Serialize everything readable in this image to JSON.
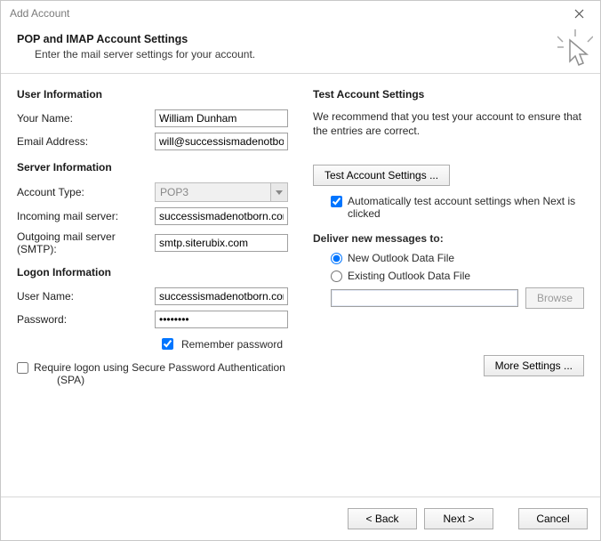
{
  "window": {
    "title": "Add Account"
  },
  "header": {
    "title": "POP and IMAP Account Settings",
    "subtitle": "Enter the mail server settings for your account."
  },
  "left": {
    "user_section": "User Information",
    "your_name_label": "Your Name:",
    "your_name_value": "William Dunham",
    "email_label": "Email Address:",
    "email_value": "will@successismadenotborn",
    "server_section": "Server Information",
    "account_type_label": "Account Type:",
    "account_type_value": "POP3",
    "incoming_label": "Incoming mail server:",
    "incoming_value": "successismadenotborn.com",
    "outgoing_label": "Outgoing mail server (SMTP):",
    "outgoing_value": "smtp.siterubix.com",
    "logon_section": "Logon Information",
    "user_name_label": "User Name:",
    "user_name_value": "successismadenotborn.com",
    "password_label": "Password:",
    "password_value": "********",
    "remember_label": "Remember password",
    "spa_label": "Require logon using Secure Password Authentication",
    "spa_label2": "(SPA)"
  },
  "right": {
    "test_section": "Test Account Settings",
    "test_para": "We recommend that you test your account to ensure that the entries are correct.",
    "test_button": "Test Account Settings ...",
    "auto_test_label": "Automatically test account settings when Next is clicked",
    "deliver_section": "Deliver new messages to:",
    "radio_new": "New Outlook Data File",
    "radio_existing": "Existing Outlook Data File",
    "path_value": "",
    "browse": "Browse",
    "more": "More Settings ..."
  },
  "footer": {
    "back": "< Back",
    "next": "Next >",
    "cancel": "Cancel"
  }
}
